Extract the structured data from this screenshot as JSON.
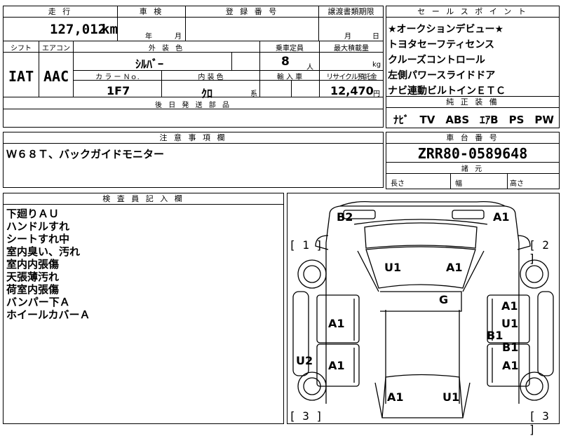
{
  "top_row": {
    "mileage_label": "走 行",
    "mileage_value": "127,012",
    "mileage_unit": "km",
    "inspection_label": "車 検",
    "inspection_year_unit": "年",
    "inspection_month_unit": "月",
    "registration_label": "登 録 番 号",
    "transfer_deadline_label": "譲渡書類期限",
    "transfer_month_unit": "月",
    "transfer_day_unit": "日"
  },
  "vehicle": {
    "shift_label": "シフト",
    "aircon_label": "エアコン",
    "exterior_color_label": "外 装 色",
    "capacity_label": "乗車定員",
    "max_load_label": "最大積載量",
    "shift_value": "IAT",
    "aircon_value": "AAC",
    "exterior_color_value": "ｼﾙﾊﾞｰ",
    "capacity_value": "8",
    "capacity_unit": "人",
    "max_load_unit": "kg",
    "color_no_label": "カ ラ ー Ｎｏ.",
    "interior_color_label": "内 装 色",
    "import_label": "輸 入 車",
    "recycle_label": "リサイクル預託金",
    "color_no_value": "1F7",
    "interior_color_value": "ｸﾛ",
    "interior_color_suffix": "系",
    "recycle_value": "12,470",
    "recycle_unit": "円",
    "aftermarket_label": "後 日 発 送 部 品"
  },
  "sales_points": {
    "label": "セ ー ル ス ポ イ ン ト",
    "items": [
      "★オークションデビュー★",
      "トヨタセーフティセンス",
      "クルーズコントロール",
      "左側パワースライドドア",
      "ナビ連動ビルトインＥＴＣ"
    ]
  },
  "genuine_equipment": {
    "label": "純 正 装 備",
    "value": "ﾅﾋﾞ　TV　ABS　ｴｱB　PS　PW"
  },
  "notes": {
    "label": "注 意 事 項 欄",
    "value": "Ｗ６８Ｔ、バックガイドモニター"
  },
  "chassis": {
    "label": "車 台 番 号",
    "value": "ZRR80-0589648"
  },
  "specs": {
    "label": "諸 元",
    "length_label": "長さ",
    "width_label": "幅",
    "height_label": "高さ"
  },
  "inspector": {
    "label": "検 査 員 記 入 欄",
    "lines": [
      "下廻りＡＵ",
      "ハンドルすれ",
      "シートすれ中",
      "室内臭い、汚れ",
      "室内内張傷",
      "天張薄汚れ",
      "荷室内張傷",
      "バンパー下Ａ",
      "ホイールカバーＡ"
    ]
  },
  "diagram": {
    "brackets": [
      "[ 1 ]",
      "[ 2 ]",
      "[ 3 ]",
      "[ 3 ]"
    ],
    "marks": [
      "B2",
      "A1",
      "U1",
      "A1",
      "G",
      "A1",
      "A1",
      "U1",
      "B1",
      "B1",
      "U2",
      "A1",
      "A1",
      "A1",
      "U1"
    ]
  }
}
